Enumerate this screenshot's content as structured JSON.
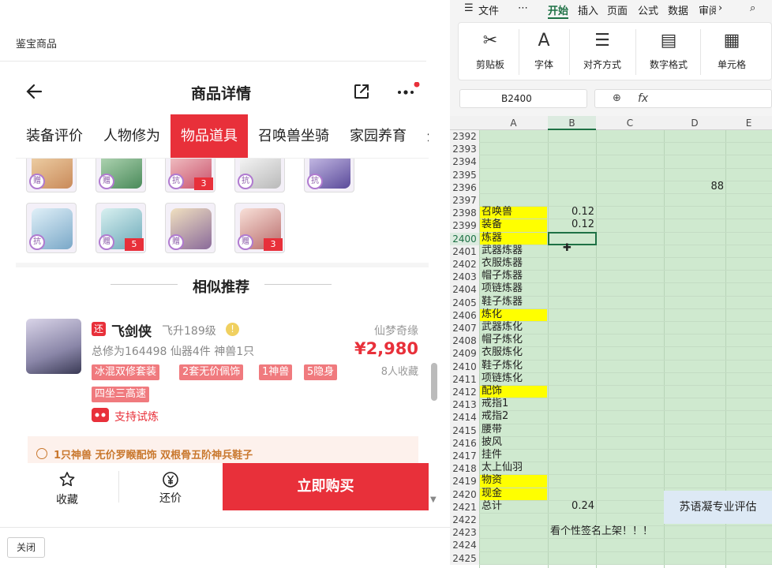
{
  "left_panel": {
    "window_title": "鉴宝商品",
    "page_title": "商品详情",
    "tabs": [
      "装备评价",
      "人物修为",
      "物品道具",
      "召唤兽坐骑",
      "家园养育",
      "外"
    ],
    "active_tab_index": 2,
    "cards_row1": [
      {
        "badge": "赠",
        "count": ""
      },
      {
        "badge": "赠",
        "count": ""
      },
      {
        "badge": "抗",
        "count": "3"
      },
      {
        "badge": "抗",
        "count": ""
      },
      {
        "badge": "抗",
        "count": ""
      }
    ],
    "cards_row2": [
      {
        "badge": "抗",
        "count": ""
      },
      {
        "badge": "赠",
        "count": "5"
      },
      {
        "badge": "赠",
        "count": ""
      },
      {
        "badge": "赠",
        "count": "3"
      }
    ],
    "similar_title": "相似推荐",
    "item": {
      "badge": "还",
      "name": "飞剑侠",
      "level": "飞升189级",
      "warn_icon": "!",
      "server": "仙梦奇缘",
      "stats": "总修为164498  仙器4件  神兽1只",
      "price": "¥2,980",
      "favorites": "8人收藏",
      "tags": [
        "冰混双修套装",
        "2套无价佩饰",
        "1神兽",
        "5隐身",
        "四坐三高速"
      ],
      "try_label": "支持试炼"
    },
    "notice": "1只神兽 无价罗睺配饰 双根骨五阶神兵鞋子",
    "buttons": {
      "favorite": "收藏",
      "bargain": "还价",
      "buy": "立即购买"
    },
    "close": "关闭"
  },
  "right_panel": {
    "menus": [
      "文件",
      "开始",
      "插入",
      "页面",
      "公式",
      "数据",
      "审阅"
    ],
    "active_menu": "开始",
    "ribbon_groups": [
      "剪贴板",
      "字体",
      "对齐方式",
      "数字格式",
      "单元格"
    ],
    "name_box": "B2400",
    "fx": "fx",
    "columns": [
      "A",
      "B",
      "C",
      "D",
      "E"
    ],
    "rows": [
      {
        "n": "2392",
        "a": "",
        "b": "",
        "d": "",
        "hl": false
      },
      {
        "n": "2393",
        "a": "",
        "b": "",
        "d": "",
        "hl": false
      },
      {
        "n": "2394",
        "a": "",
        "b": "",
        "d": "",
        "hl": false
      },
      {
        "n": "2395",
        "a": "",
        "b": "",
        "d": "",
        "hl": false
      },
      {
        "n": "2396",
        "a": "",
        "b": "",
        "d": "88",
        "hl": false
      },
      {
        "n": "2397",
        "a": "",
        "b": "",
        "d": "",
        "hl": false
      },
      {
        "n": "2398",
        "a": "召唤兽",
        "b": "0.12",
        "d": "",
        "hl": true
      },
      {
        "n": "2399",
        "a": "装备",
        "b": "0.12",
        "d": "",
        "hl": true
      },
      {
        "n": "2400",
        "a": "炼器",
        "b": "",
        "d": "",
        "hl": true
      },
      {
        "n": "2401",
        "a": "武器炼器",
        "b": "",
        "d": "",
        "hl": false
      },
      {
        "n": "2402",
        "a": "衣服炼器",
        "b": "",
        "d": "",
        "hl": false
      },
      {
        "n": "2403",
        "a": "帽子炼器",
        "b": "",
        "d": "",
        "hl": false
      },
      {
        "n": "2404",
        "a": "项链炼器",
        "b": "",
        "d": "",
        "hl": false
      },
      {
        "n": "2405",
        "a": "鞋子炼器",
        "b": "",
        "d": "",
        "hl": false
      },
      {
        "n": "2406",
        "a": "炼化",
        "b": "",
        "d": "",
        "hl": true
      },
      {
        "n": "2407",
        "a": "武器炼化",
        "b": "",
        "d": "",
        "hl": false
      },
      {
        "n": "2408",
        "a": "帽子炼化",
        "b": "",
        "d": "",
        "hl": false
      },
      {
        "n": "2409",
        "a": "衣服炼化",
        "b": "",
        "d": "",
        "hl": false
      },
      {
        "n": "2410",
        "a": "鞋子炼化",
        "b": "",
        "d": "",
        "hl": false
      },
      {
        "n": "2411",
        "a": "项链炼化",
        "b": "",
        "d": "",
        "hl": false
      },
      {
        "n": "2412",
        "a": "配饰",
        "b": "",
        "d": "",
        "hl": true
      },
      {
        "n": "2413",
        "a": "戒指1",
        "b": "",
        "d": "",
        "hl": false
      },
      {
        "n": "2414",
        "a": "戒指2",
        "b": "",
        "d": "",
        "hl": false
      },
      {
        "n": "2415",
        "a": "腰带",
        "b": "",
        "d": "",
        "hl": false
      },
      {
        "n": "2416",
        "a": "披风",
        "b": "",
        "d": "",
        "hl": false
      },
      {
        "n": "2417",
        "a": "挂件",
        "b": "",
        "d": "",
        "hl": false
      },
      {
        "n": "2418",
        "a": "太上仙羽",
        "b": "",
        "d": "",
        "hl": false
      },
      {
        "n": "2419",
        "a": "物资",
        "b": "",
        "d": "",
        "hl": true
      },
      {
        "n": "2420",
        "a": "现金",
        "b": "",
        "d": "",
        "hl": true
      },
      {
        "n": "2421",
        "a": "总计",
        "b": "0.24",
        "d": "",
        "hl": false
      },
      {
        "n": "2422",
        "a": "",
        "b": "",
        "d": "",
        "hl": false
      },
      {
        "n": "2423",
        "a": "",
        "b": "看个性签名上架！！！",
        "d": "",
        "hl": false
      },
      {
        "n": "2424",
        "a": "",
        "b": "",
        "d": "",
        "hl": false
      },
      {
        "n": "2425",
        "a": "",
        "b": "",
        "d": "",
        "hl": false
      }
    ],
    "appraisal": "苏语凝专业评估",
    "colors": {
      "green": "#cfe9cf",
      "yellow": "#ffff00",
      "accent": "#1e7145"
    }
  },
  "colors": {
    "red": "#e8303a"
  }
}
